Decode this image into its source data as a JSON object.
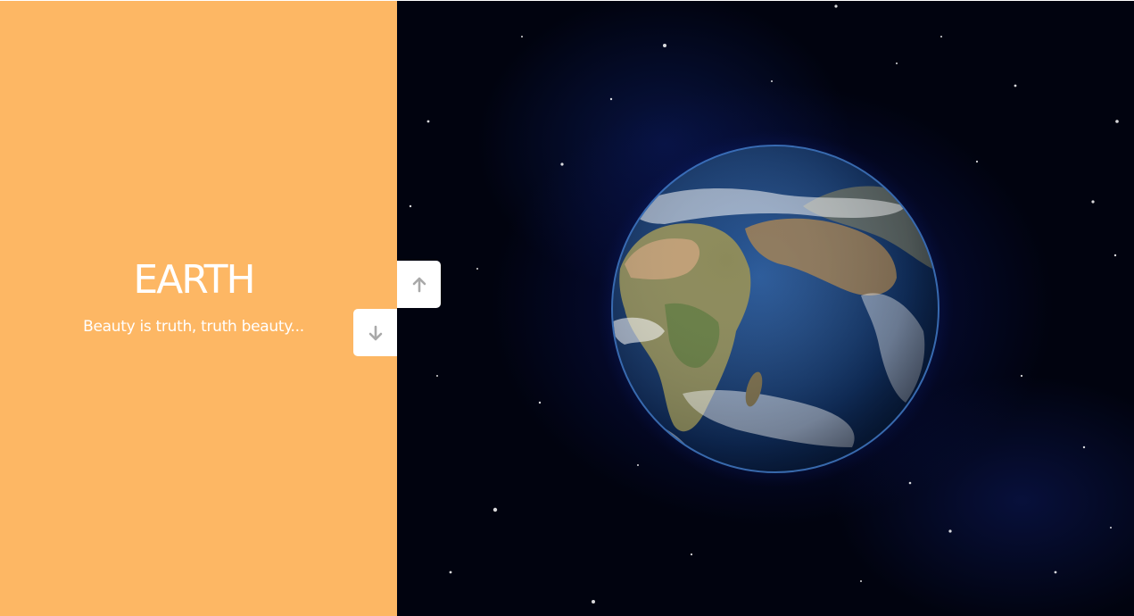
{
  "slide": {
    "title": "EARTH",
    "subtitle": "Beauty is truth, truth beauty...",
    "panel_color": "#fdb764",
    "text_color": "#ffffff"
  },
  "image": {
    "subject": "planet-earth-in-space"
  },
  "navigation": {
    "up_icon": "arrow-up-icon",
    "down_icon": "arrow-down-icon",
    "icon_color": "#a9a9a9"
  }
}
